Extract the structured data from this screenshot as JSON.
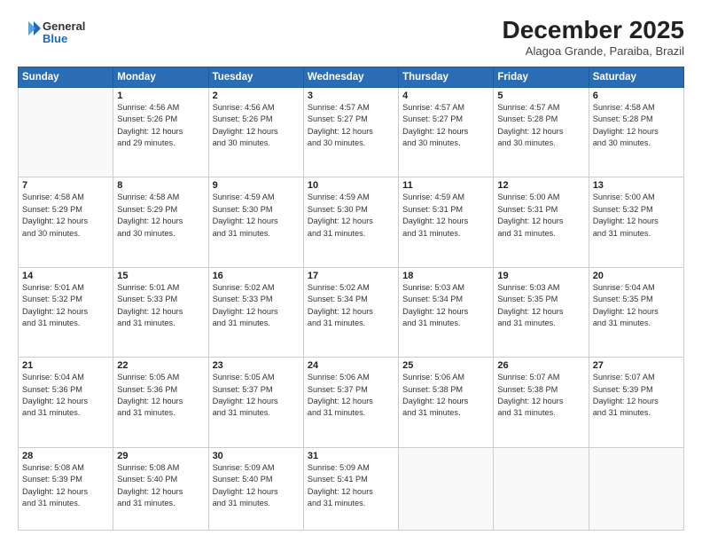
{
  "logo": {
    "general": "General",
    "blue": "Blue"
  },
  "header": {
    "month": "December 2025",
    "location": "Alagoa Grande, Paraiba, Brazil"
  },
  "weekdays": [
    "Sunday",
    "Monday",
    "Tuesday",
    "Wednesday",
    "Thursday",
    "Friday",
    "Saturday"
  ],
  "weeks": [
    [
      {
        "day": "",
        "info": ""
      },
      {
        "day": "1",
        "info": "Sunrise: 4:56 AM\nSunset: 5:26 PM\nDaylight: 12 hours\nand 29 minutes."
      },
      {
        "day": "2",
        "info": "Sunrise: 4:56 AM\nSunset: 5:26 PM\nDaylight: 12 hours\nand 30 minutes."
      },
      {
        "day": "3",
        "info": "Sunrise: 4:57 AM\nSunset: 5:27 PM\nDaylight: 12 hours\nand 30 minutes."
      },
      {
        "day": "4",
        "info": "Sunrise: 4:57 AM\nSunset: 5:27 PM\nDaylight: 12 hours\nand 30 minutes."
      },
      {
        "day": "5",
        "info": "Sunrise: 4:57 AM\nSunset: 5:28 PM\nDaylight: 12 hours\nand 30 minutes."
      },
      {
        "day": "6",
        "info": "Sunrise: 4:58 AM\nSunset: 5:28 PM\nDaylight: 12 hours\nand 30 minutes."
      }
    ],
    [
      {
        "day": "7",
        "info": "Sunrise: 4:58 AM\nSunset: 5:29 PM\nDaylight: 12 hours\nand 30 minutes."
      },
      {
        "day": "8",
        "info": "Sunrise: 4:58 AM\nSunset: 5:29 PM\nDaylight: 12 hours\nand 30 minutes."
      },
      {
        "day": "9",
        "info": "Sunrise: 4:59 AM\nSunset: 5:30 PM\nDaylight: 12 hours\nand 31 minutes."
      },
      {
        "day": "10",
        "info": "Sunrise: 4:59 AM\nSunset: 5:30 PM\nDaylight: 12 hours\nand 31 minutes."
      },
      {
        "day": "11",
        "info": "Sunrise: 4:59 AM\nSunset: 5:31 PM\nDaylight: 12 hours\nand 31 minutes."
      },
      {
        "day": "12",
        "info": "Sunrise: 5:00 AM\nSunset: 5:31 PM\nDaylight: 12 hours\nand 31 minutes."
      },
      {
        "day": "13",
        "info": "Sunrise: 5:00 AM\nSunset: 5:32 PM\nDaylight: 12 hours\nand 31 minutes."
      }
    ],
    [
      {
        "day": "14",
        "info": "Sunrise: 5:01 AM\nSunset: 5:32 PM\nDaylight: 12 hours\nand 31 minutes."
      },
      {
        "day": "15",
        "info": "Sunrise: 5:01 AM\nSunset: 5:33 PM\nDaylight: 12 hours\nand 31 minutes."
      },
      {
        "day": "16",
        "info": "Sunrise: 5:02 AM\nSunset: 5:33 PM\nDaylight: 12 hours\nand 31 minutes."
      },
      {
        "day": "17",
        "info": "Sunrise: 5:02 AM\nSunset: 5:34 PM\nDaylight: 12 hours\nand 31 minutes."
      },
      {
        "day": "18",
        "info": "Sunrise: 5:03 AM\nSunset: 5:34 PM\nDaylight: 12 hours\nand 31 minutes."
      },
      {
        "day": "19",
        "info": "Sunrise: 5:03 AM\nSunset: 5:35 PM\nDaylight: 12 hours\nand 31 minutes."
      },
      {
        "day": "20",
        "info": "Sunrise: 5:04 AM\nSunset: 5:35 PM\nDaylight: 12 hours\nand 31 minutes."
      }
    ],
    [
      {
        "day": "21",
        "info": "Sunrise: 5:04 AM\nSunset: 5:36 PM\nDaylight: 12 hours\nand 31 minutes."
      },
      {
        "day": "22",
        "info": "Sunrise: 5:05 AM\nSunset: 5:36 PM\nDaylight: 12 hours\nand 31 minutes."
      },
      {
        "day": "23",
        "info": "Sunrise: 5:05 AM\nSunset: 5:37 PM\nDaylight: 12 hours\nand 31 minutes."
      },
      {
        "day": "24",
        "info": "Sunrise: 5:06 AM\nSunset: 5:37 PM\nDaylight: 12 hours\nand 31 minutes."
      },
      {
        "day": "25",
        "info": "Sunrise: 5:06 AM\nSunset: 5:38 PM\nDaylight: 12 hours\nand 31 minutes."
      },
      {
        "day": "26",
        "info": "Sunrise: 5:07 AM\nSunset: 5:38 PM\nDaylight: 12 hours\nand 31 minutes."
      },
      {
        "day": "27",
        "info": "Sunrise: 5:07 AM\nSunset: 5:39 PM\nDaylight: 12 hours\nand 31 minutes."
      }
    ],
    [
      {
        "day": "28",
        "info": "Sunrise: 5:08 AM\nSunset: 5:39 PM\nDaylight: 12 hours\nand 31 minutes."
      },
      {
        "day": "29",
        "info": "Sunrise: 5:08 AM\nSunset: 5:40 PM\nDaylight: 12 hours\nand 31 minutes."
      },
      {
        "day": "30",
        "info": "Sunrise: 5:09 AM\nSunset: 5:40 PM\nDaylight: 12 hours\nand 31 minutes."
      },
      {
        "day": "31",
        "info": "Sunrise: 5:09 AM\nSunset: 5:41 PM\nDaylight: 12 hours\nand 31 minutes."
      },
      {
        "day": "",
        "info": ""
      },
      {
        "day": "",
        "info": ""
      },
      {
        "day": "",
        "info": ""
      }
    ]
  ]
}
